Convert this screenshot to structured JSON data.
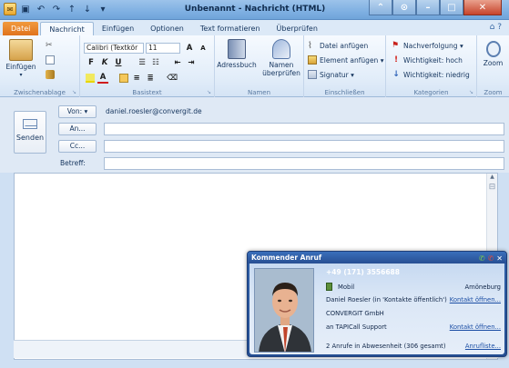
{
  "window": {
    "title": "Unbenannt - Nachricht (HTML)"
  },
  "tabs": [
    "Datei",
    "Nachricht",
    "Einfügen",
    "Optionen",
    "Text formatieren",
    "Überprüfen"
  ],
  "ribbon": {
    "clipboard": {
      "paste": "Einfügen",
      "label": "Zwischenablage"
    },
    "basictext": {
      "font": "Calibri (Textkör",
      "size": "11",
      "label": "Basistext"
    },
    "names": {
      "addressbook": "Adressbuch",
      "checknames_1": "Namen",
      "checknames_2": "überprüfen",
      "label": "Namen"
    },
    "include": {
      "attach_file": "Datei anfügen",
      "attach_item": "Element anfügen ▾",
      "signature": "Signatur ▾",
      "label": "Einschließen"
    },
    "tags": {
      "followup": "Nachverfolgung ▾",
      "high": "Wichtigkeit: hoch",
      "low": "Wichtigkeit: niedrig",
      "label": "Kategorien"
    },
    "zoom": {
      "button": "Zoom",
      "label": "Zoom"
    }
  },
  "header": {
    "send": "Senden",
    "from_button": "Von: ▾",
    "from_value": "daniel.roesler@convergit.de",
    "to_button": "An...",
    "cc_button": "Cc...",
    "subject_label": "Betreff:"
  },
  "popup": {
    "title": "Kommender Anruf",
    "number": "+49 (171) 3556688",
    "phone_type": "Mobil",
    "location": "Amöneburg",
    "contact_line": "Daniel Roesler (in 'Kontakte öffentlich')",
    "company": "CONVERGIT GmbH",
    "to_line": "an TAPICall Support",
    "missed": "2 Anrufe in Abwesenheit (306 gesamt)",
    "link_contact1": "Kontakt öffnen...",
    "link_contact2": "Kontakt öffnen...",
    "link_calllist": "Anrufliste..."
  },
  "colors": {
    "file_tab": "#e0731c",
    "popup_title": "#274f93",
    "link": "#1a4da4"
  }
}
